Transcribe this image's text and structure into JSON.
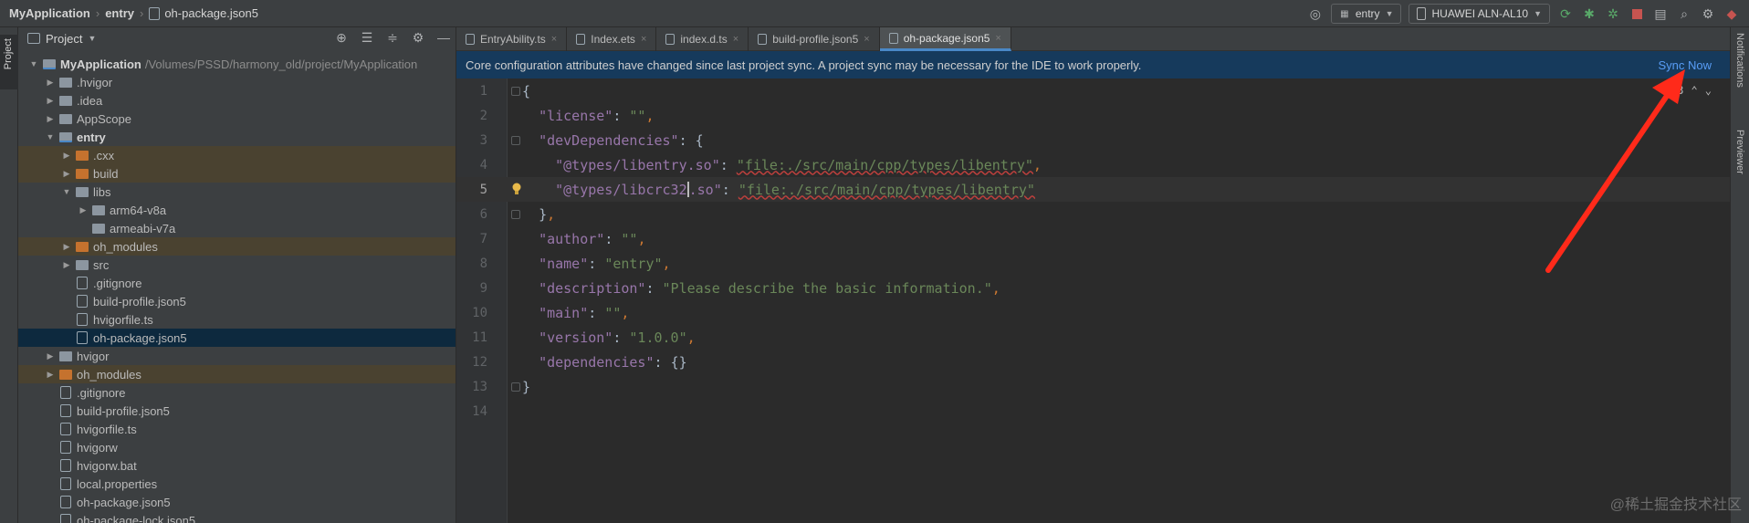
{
  "breadcrumb": [
    "MyApplication",
    "entry",
    "oh-package.json5"
  ],
  "toolbar": {
    "module_combo": "entry",
    "device_combo": "HUAWEI ALN-AL10"
  },
  "project_panel": {
    "title": "Project",
    "tree": [
      {
        "indent": 0,
        "arrow": "down",
        "kind": "module",
        "name": "MyApplication",
        "bold": true,
        "path": "/Volumes/PSSD/harmony_old/project/MyApplication"
      },
      {
        "indent": 1,
        "arrow": "right",
        "kind": "folder",
        "name": ".hvigor"
      },
      {
        "indent": 1,
        "arrow": "right",
        "kind": "folder",
        "name": ".idea"
      },
      {
        "indent": 1,
        "arrow": "right",
        "kind": "folder",
        "name": "AppScope"
      },
      {
        "indent": 1,
        "arrow": "down",
        "kind": "module",
        "name": "entry",
        "bold": true
      },
      {
        "indent": 2,
        "arrow": "right",
        "kind": "orange",
        "name": ".cxx",
        "excluded": true
      },
      {
        "indent": 2,
        "arrow": "right",
        "kind": "orange",
        "name": "build",
        "excluded": true
      },
      {
        "indent": 2,
        "arrow": "down",
        "kind": "folder",
        "name": "libs"
      },
      {
        "indent": 3,
        "arrow": "right",
        "kind": "folder",
        "name": "arm64-v8a"
      },
      {
        "indent": 3,
        "arrow": "none",
        "kind": "folder",
        "name": "armeabi-v7a"
      },
      {
        "indent": 2,
        "arrow": "right",
        "kind": "orange",
        "name": "oh_modules",
        "excluded": true
      },
      {
        "indent": 2,
        "arrow": "right",
        "kind": "folder",
        "name": "src"
      },
      {
        "indent": 2,
        "arrow": "none",
        "kind": "file",
        "name": ".gitignore"
      },
      {
        "indent": 2,
        "arrow": "none",
        "kind": "file",
        "name": "build-profile.json5"
      },
      {
        "indent": 2,
        "arrow": "none",
        "kind": "file",
        "name": "hvigorfile.ts"
      },
      {
        "indent": 2,
        "arrow": "none",
        "kind": "file",
        "name": "oh-package.json5",
        "selected": true
      },
      {
        "indent": 1,
        "arrow": "right",
        "kind": "folder",
        "name": "hvigor"
      },
      {
        "indent": 1,
        "arrow": "right",
        "kind": "orange",
        "name": "oh_modules",
        "excluded": true
      },
      {
        "indent": 1,
        "arrow": "none",
        "kind": "file",
        "name": ".gitignore"
      },
      {
        "indent": 1,
        "arrow": "none",
        "kind": "file",
        "name": "build-profile.json5"
      },
      {
        "indent": 1,
        "arrow": "none",
        "kind": "file",
        "name": "hvigorfile.ts"
      },
      {
        "indent": 1,
        "arrow": "none",
        "kind": "file",
        "name": "hvigorw"
      },
      {
        "indent": 1,
        "arrow": "none",
        "kind": "file",
        "name": "hvigorw.bat"
      },
      {
        "indent": 1,
        "arrow": "none",
        "kind": "file",
        "name": "local.properties"
      },
      {
        "indent": 1,
        "arrow": "none",
        "kind": "file",
        "name": "oh-package.json5"
      },
      {
        "indent": 1,
        "arrow": "none",
        "kind": "file",
        "name": "oh-package-lock.json5"
      }
    ]
  },
  "tabs": [
    {
      "label": "EntryAbility.ts",
      "active": false
    },
    {
      "label": "Index.ets",
      "active": false
    },
    {
      "label": "index.d.ts",
      "active": false
    },
    {
      "label": "build-profile.json5",
      "active": false
    },
    {
      "label": "oh-package.json5",
      "active": true
    }
  ],
  "banner": {
    "message": "Core configuration attributes have changed since last project sync. A project sync may be necessary for the IDE to work properly.",
    "action": "Sync Now"
  },
  "inspections": {
    "errors": "3"
  },
  "code_lines": [
    "{",
    "  \"license\": \"\",",
    "  \"devDependencies\": {",
    "    \"@types/libentry.so\": \"file:./src/main/cpp/types/libentry\",",
    "    \"@types/libcrc32.so\": \"file:./src/main/cpp/types/libentry\"",
    "  },",
    "  \"author\": \"\",",
    "  \"name\": \"entry\",",
    "  \"description\": \"Please describe the basic information.\",",
    "  \"main\": \"\",",
    "  \"version\": \"1.0.0\",",
    "  \"dependencies\": {}",
    "}",
    ""
  ],
  "right_stripe": [
    "Notifications",
    "Previewer"
  ],
  "watermark": "@稀土掘金技术社区"
}
